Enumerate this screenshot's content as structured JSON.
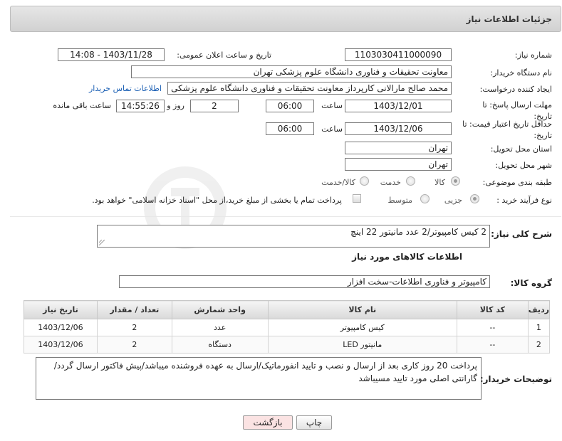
{
  "header": {
    "title": "جزئیات اطلاعات نیاز"
  },
  "form": {
    "need_number_label": "شماره نیاز:",
    "need_number": "1103030411000090",
    "announce_label": "تاریخ و ساعت اعلان عمومی:",
    "announce_value": "1403/11/28 - 14:08",
    "buyer_label": "نام دستگاه خریدار:",
    "buyer_value": "معاونت تحقیقات و فناوری دانشگاه علوم پزشکی تهران",
    "creator_label": "ایجاد کننده درخواست:",
    "creator_value": "محمد صالح مارالانی کارپرداز معاونت تحقیقات و فناوری دانشگاه علوم پزشکی تهران",
    "contact_link": "اطلاعات تماس خریدار",
    "deadline_label": "مهلت ارسال پاسخ: تا تاریخ:",
    "deadline_date": "1403/12/01",
    "time_label": "ساعت",
    "deadline_time": "06:00",
    "days_count": "2",
    "days_label": "روز و",
    "remaining_time": "14:55:26",
    "remaining_label": "ساعت باقی مانده",
    "validity_label": "حداقل تاریخ اعتبار قیمت: تا تاریخ:",
    "validity_date": "1403/12/06",
    "validity_time": "06:00",
    "province_label": "استان محل تحویل:",
    "province_value": "تهران",
    "city_label": "شهر محل تحویل:",
    "city_value": "تهران",
    "category_label": "طبقه بندی موضوعی:",
    "category_options": [
      "کالا",
      "خدمت",
      "کالا/خدمت"
    ],
    "category_selected": "کالا",
    "process_label": "نوع فرآیند خرید :",
    "process_options": [
      "جزیی",
      "متوسط"
    ],
    "process_selected": "جزیی",
    "payment_note": "پرداخت تمام یا بخشی از مبلغ خرید،از محل \"اسناد خزانه اسلامی\" خواهد بود.",
    "description_label": "شرح کلی نیاز:",
    "description_value": "2 کیس کامپیوتر/2 عدد مانیتور 22 اینچ",
    "goods_info_title": "اطلاعات کالاهای مورد نیاز",
    "goods_group_label": "گروه کالا:",
    "goods_group_value": "کامپیوتر و فناوری اطلاعات-سخت افزار",
    "buyer_notes_label": "توضیحات خریدار:",
    "buyer_notes_value": "پرداخت 20 روز کاری بعد از ارسال و نصب و تایید انفورماتیک/ارسال به عهده فروشنده میباشد/پیش فاکتور ارسال گردد/گارانتی اصلی مورد تایید مسیباشد"
  },
  "table": {
    "headers": [
      "ردیف",
      "کد کالا",
      "نام کالا",
      "واحد شمارش",
      "تعداد / مقدار",
      "تاریخ نیاز"
    ],
    "rows": [
      [
        "1",
        "--",
        "کیس کامپیوتر",
        "عدد",
        "2",
        "1403/12/06"
      ],
      [
        "2",
        "--",
        "مانیتور LED",
        "دستگاه",
        "2",
        "1403/12/06"
      ]
    ]
  },
  "buttons": {
    "print": "چاپ",
    "back": "بازگشت"
  },
  "watermark": {
    "text": "AriaTender.neT"
  },
  "colors": {
    "link": "#1a5fb4",
    "back_button_bg": "#fbe3e3",
    "header_bg": "#d9d9d9"
  }
}
